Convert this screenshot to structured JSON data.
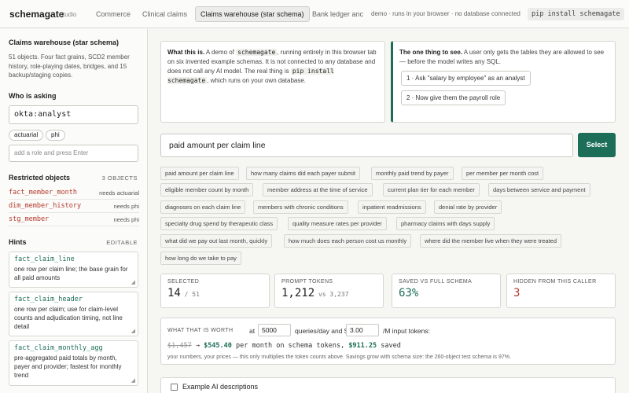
{
  "app": {
    "brand": "schemagate",
    "brand_sub": "studio"
  },
  "tabs": [
    "Commerce",
    "Clinical claims",
    "Claims warehouse (star schema)",
    "Bank ledger anc"
  ],
  "top_note": "demo · runs in your browser · no database connected",
  "pip_command": "pip install schemagate",
  "sidebar": {
    "title": "Claims warehouse (star schema)",
    "description": "51 objects. Four fact grains, SCD2 member history, role-playing dates, bridges, and 15 backup/staging copies.",
    "who_heading": "Who is asking",
    "who_value": "okta:analyst",
    "roles": [
      "actuarial",
      "phi"
    ],
    "role_placeholder": "add a role and press Enter",
    "restricted_heading": "Restricted objects",
    "restricted_count": "3 OBJECTS",
    "restricted": [
      {
        "name": "fact_member_month",
        "need": "needs actuarial"
      },
      {
        "name": "dim_member_history",
        "need": "needs phi"
      },
      {
        "name": "stg_member",
        "need": "needs phi"
      }
    ],
    "hints_heading": "Hints",
    "hints_editable": "EDITABLE",
    "hints": [
      {
        "name": "fact_claim_line",
        "text": "one row per claim line; the base grain for all paid amounts"
      },
      {
        "name": "fact_claim_header",
        "text": "one row per claim; use for claim-level counts and adjudication timing, not line detail"
      },
      {
        "name": "fact_claim_monthly_agg",
        "text": "pre-aggregated paid totals by month, payer and provider; fastest for monthly trend"
      }
    ]
  },
  "info": {
    "lead": "What this is.",
    "t1": " A demo of ",
    "chip1": "schemagate",
    "t2": ", running entirely in this browser tab on six invented example schemas. It is not connected to any database and does not call any AI model. The real thing is ",
    "chip2": "pip install schemagate",
    "t3": ", which runs on your own database."
  },
  "see": {
    "lead": "The one thing to see.",
    "text": " A user only gets the tables they are allowed to see — before the model writes any SQL.",
    "step1": "1 · Ask \"salary by employee\" as an analyst",
    "step2": "2 · Now give them the payroll role"
  },
  "query": {
    "value": "paid amount per claim line",
    "button": "Select"
  },
  "suggestions": [
    "paid amount per claim line",
    "how many claims did each payer submit",
    "monthly paid trend by payer",
    "per member per month cost",
    "eligible member count by month",
    "member address at the time of service",
    "current plan tier for each member",
    "days between service and payment",
    "diagnoses on each claim line",
    "members with chronic conditions",
    "inpatient readmissions",
    "denial rate by provider",
    "specialty drug spend by therapeutic class",
    "quality measure rates per provider",
    "pharmacy claims with days supply",
    "what did we pay out last month, quickly",
    "how much does each person cost us monthly",
    "where did the member live when they were treated",
    "how long do we take to pay"
  ],
  "stats": [
    {
      "label": "SELECTED",
      "value": "14",
      "sub": " / 51",
      "color": "#222222"
    },
    {
      "label": "PROMPT TOKENS",
      "value": "1,212",
      "sub": " vs 3,237",
      "color": "#222222"
    },
    {
      "label": "SAVED VS FULL SCHEMA",
      "value": "63%",
      "sub": "",
      "color": "#1d6e58"
    },
    {
      "label": "HIDDEN FROM THIS CALLER",
      "value": "3",
      "sub": "",
      "color": "#b43a2e"
    }
  ],
  "worth": {
    "label": "WHAT THAT IS WORTH",
    "at": "at",
    "queries_value": "5000",
    "queries_text": "queries/day and $",
    "price_value": "3.00",
    "price_text": "/M input tokens:",
    "old_value": "$1,457",
    "arrow": " → ",
    "new_value": "$545.40",
    "per_month": " per month on schema tokens, ",
    "saved_value": "$911.25",
    "saved_text": " saved",
    "fine": "your numbers, your prices — this only multiplies the token counts above. Savings grow with schema size: the 260-object test schema is 97%."
  },
  "ai_descriptions": "Example AI descriptions"
}
